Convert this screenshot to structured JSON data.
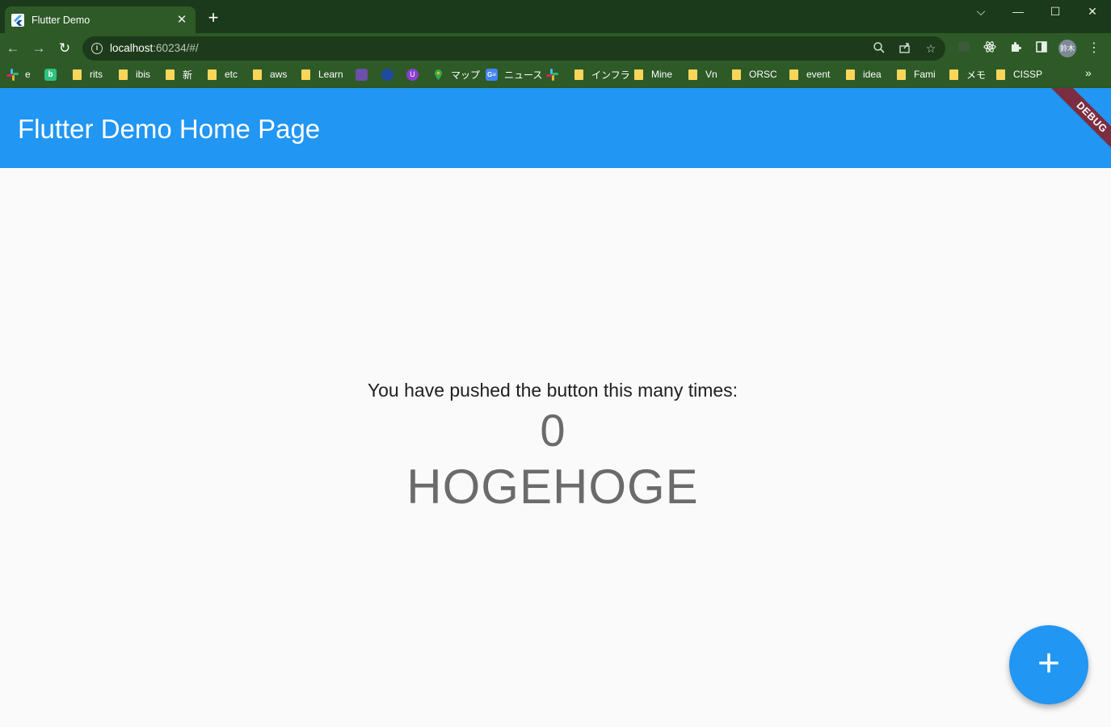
{
  "browser": {
    "tab": {
      "title": "Flutter Demo",
      "close": "✕"
    },
    "new_tab": "+",
    "window": {
      "dropdown": "⌵",
      "minimize": "—",
      "maximize": "☐",
      "close": "✕"
    },
    "nav": {
      "back": "←",
      "forward": "→",
      "reload": "↻"
    },
    "url": {
      "host": "localhost",
      "rest": ":60234/#/"
    },
    "profile": "鈴木",
    "bookmarks": [
      {
        "label": "e",
        "icon": "slack-icon"
      },
      {
        "label": "",
        "icon": "b-app-icon"
      },
      {
        "label": "rits",
        "icon": "folder-icon"
      },
      {
        "label": "ibis",
        "icon": "folder-icon"
      },
      {
        "label": "新",
        "icon": "folder-icon"
      },
      {
        "label": "etc",
        "icon": "folder-icon"
      },
      {
        "label": "aws",
        "icon": "folder-icon"
      },
      {
        "label": "Learn",
        "icon": "folder-icon"
      },
      {
        "label": "",
        "icon": "app-icon"
      },
      {
        "label": "",
        "icon": "app-icon"
      },
      {
        "label": "",
        "icon": "app-icon"
      },
      {
        "label": "マップ",
        "icon": "maps-icon"
      },
      {
        "label": "ニュース",
        "icon": "news-icon"
      },
      {
        "label": "",
        "icon": "slack-icon"
      },
      {
        "label": "インフラ",
        "icon": "folder-icon"
      },
      {
        "label": "Mine",
        "icon": "folder-icon"
      },
      {
        "label": "Vn",
        "icon": "folder-icon"
      },
      {
        "label": "ORSC",
        "icon": "folder-icon"
      },
      {
        "label": "event",
        "icon": "folder-icon"
      },
      {
        "label": "idea",
        "icon": "folder-icon"
      },
      {
        "label": "Fami",
        "icon": "folder-icon"
      },
      {
        "label": "メモ",
        "icon": "folder-icon"
      },
      {
        "label": "CISSP",
        "icon": "folder-icon"
      }
    ],
    "bookmarks_more": "»"
  },
  "app": {
    "title": "Flutter Demo Home Page",
    "debug_banner": "DEBUG",
    "message": "You have pushed the button this many times:",
    "counter": "0",
    "extra_text": "HOGEHOGE",
    "fab_icon": "+"
  },
  "colors": {
    "primary": "#2196f3",
    "browser_frame": "#2d5a27",
    "debug_banner": "#7b2d42",
    "bookmark_folder": "#f9d65a"
  }
}
